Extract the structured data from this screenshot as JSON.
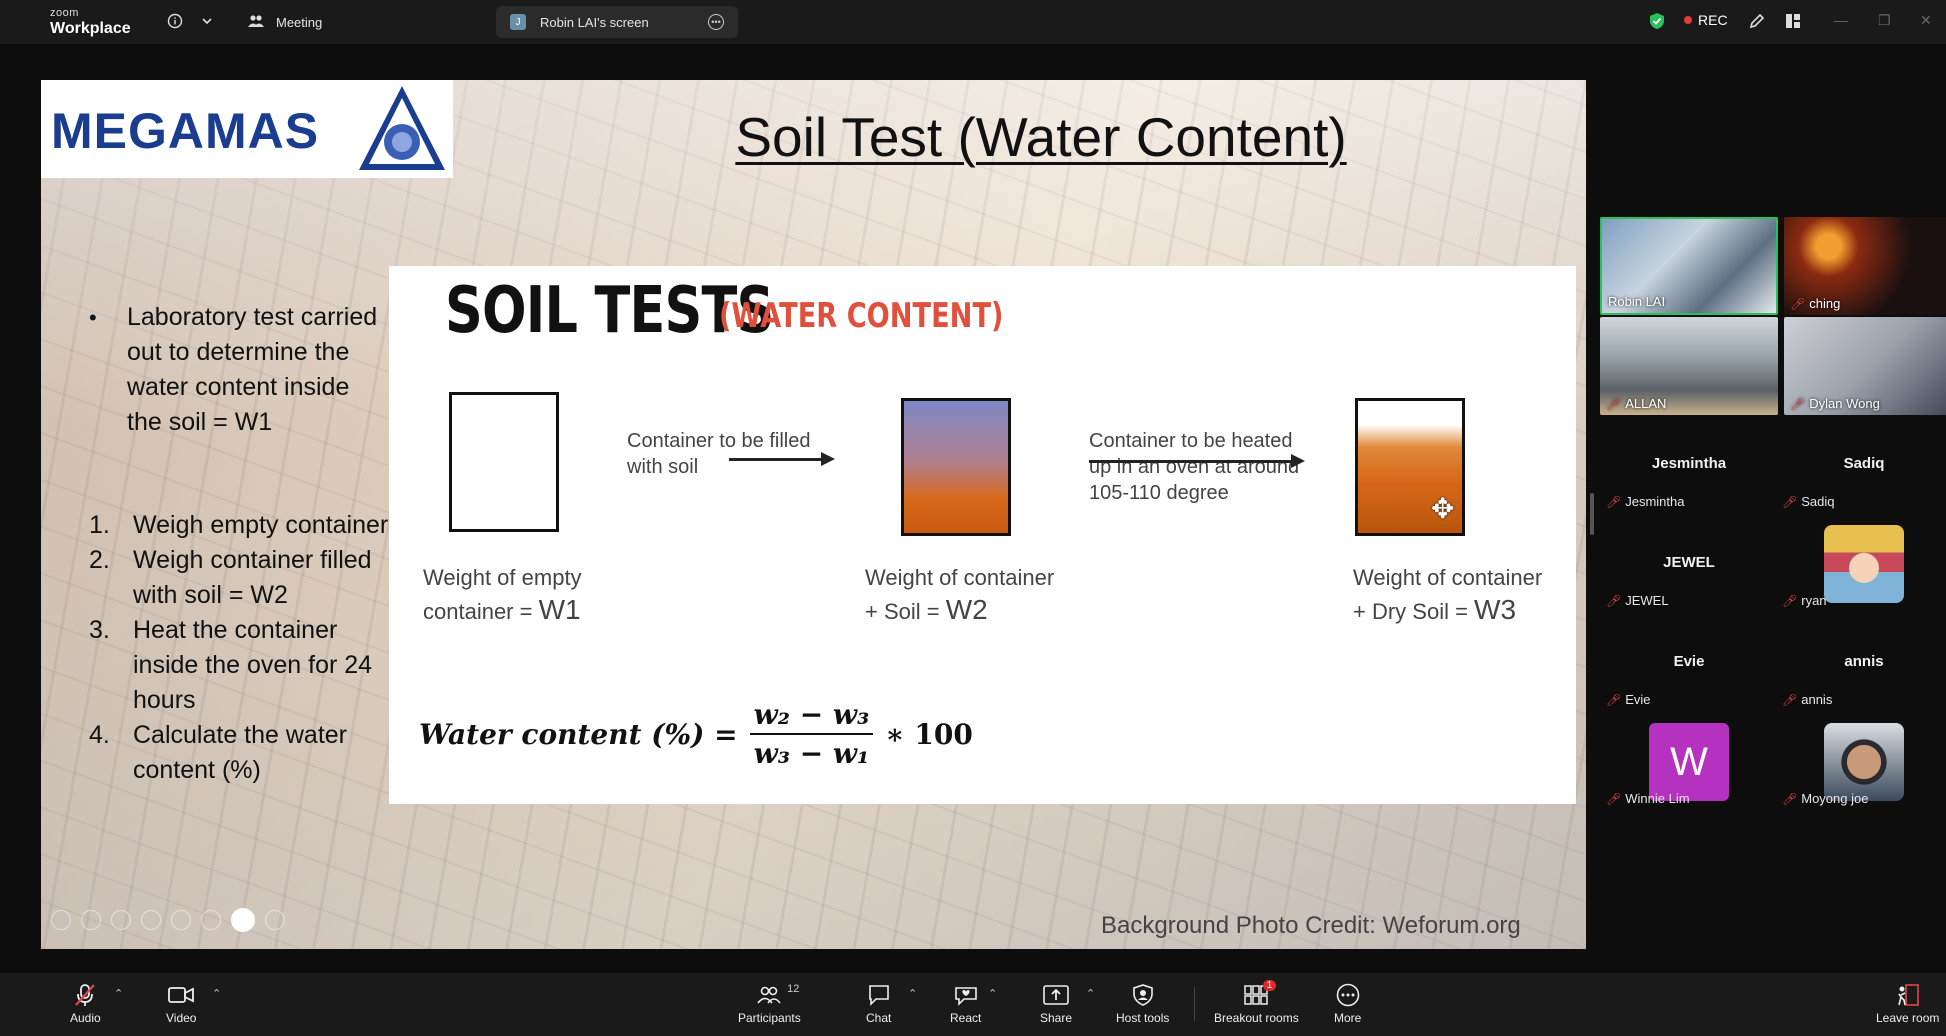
{
  "topbar": {
    "brand_small": "zoom",
    "brand_big": "Workplace",
    "meeting_tab": "Meeting",
    "screen_tab_badge": "J",
    "screen_tab": "Robin LAI's screen",
    "rec": "REC"
  },
  "slide": {
    "logo_text": "MEGAMAS",
    "title": "Soil Test (Water Content)",
    "bullets": [
      "Laboratory test carried out to determine the water content inside the soil = W1"
    ],
    "steps": [
      {
        "n": "1.",
        "text": "Weigh empty container"
      },
      {
        "n": "2.",
        "text": "Weigh container filled with soil = W2"
      },
      {
        "n": "3.",
        "text": "Heat the container inside the oven for 24 hours"
      },
      {
        "n": "4.",
        "text": "Calculate the water content (%)"
      }
    ],
    "inner_title": "SOIL TESTS",
    "inner_subtitle": "(WATER CONTENT)",
    "arrow1_line1": "Container to be filled",
    "arrow1_line2": "with soil",
    "arrow2_line1": "Container to be heated",
    "arrow2_line2": "up in an oven at around",
    "arrow2_line3": "105-110 degree",
    "cap1_line1": "Weight of empty",
    "cap1_line2": "container = ",
    "cap1_w": "W1",
    "cap2_line1": "Weight of container",
    "cap2_line2": "+ Soil = ",
    "cap2_w": "W2",
    "cap3_line1": "Weight of container",
    "cap3_line2": "+ Dry Soil = ",
    "cap3_w": "W3",
    "formula_label": "Water content (%) =",
    "formula_num": "w₂ − w₃",
    "formula_den": "w₃ − w₁",
    "formula_tail": "∗ 100",
    "credit": "Background Photo Credit: Weforum.org"
  },
  "gallery": {
    "video_tiles": [
      "Robin LAI",
      "ching",
      "ALLAN",
      "Dylan Wong"
    ],
    "name_tiles": [
      {
        "big": "Jesmintha",
        "small": "Jesmintha"
      },
      {
        "big": "Sadiq",
        "small": "Sadiq"
      },
      {
        "big": "JEWEL",
        "small": "JEWEL"
      },
      {
        "big": "",
        "small": "ryan"
      },
      {
        "big": "Evie",
        "small": "Evie"
      },
      {
        "big": "annis",
        "small": "annis"
      },
      {
        "big": "",
        "small": "Winnie Lim"
      },
      {
        "big": "",
        "small": "Moyong joe"
      }
    ],
    "winnie_initial": "W"
  },
  "toolbar": {
    "audio": "Audio",
    "video": "Video",
    "participants": "Participants",
    "participants_count": "12",
    "chat": "Chat",
    "react": "React",
    "share": "Share",
    "host_tools": "Host tools",
    "breakout": "Breakout rooms",
    "breakout_badge": "1",
    "more": "More",
    "leave": "Leave room"
  },
  "colors": {
    "accent_green": "#27c25a",
    "rec_red": "#e23b3b",
    "inner_subtitle_red": "#e0503c",
    "logo_blue": "#1a3d8f",
    "soil_orange": "#d8681a",
    "soil_blue": "#7f88c8"
  }
}
